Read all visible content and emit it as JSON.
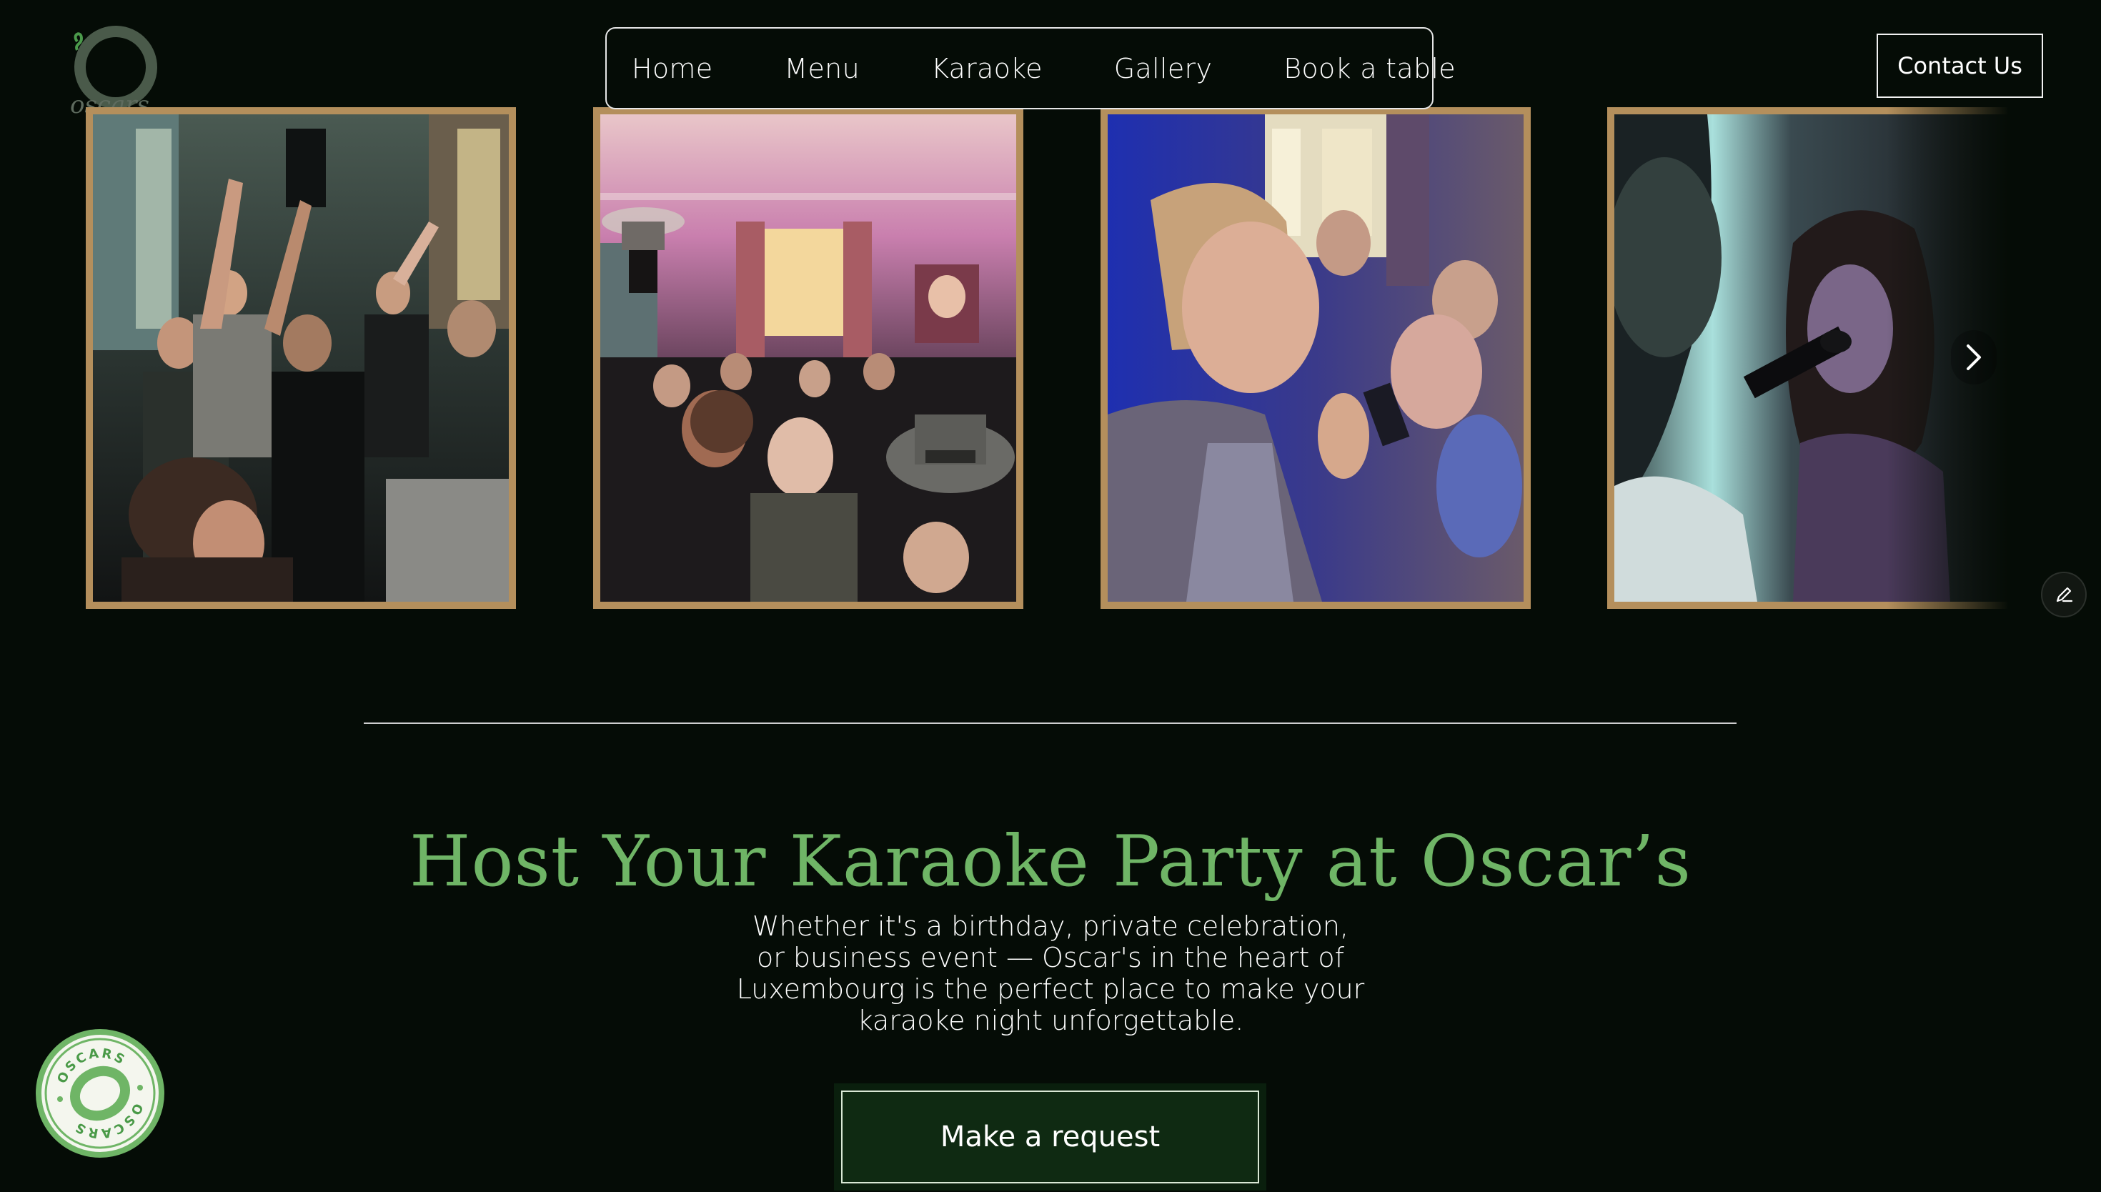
{
  "brand": {
    "logo_text": "oscars",
    "logo_letter": "O"
  },
  "nav": {
    "items": [
      {
        "label": "Home"
      },
      {
        "label": "Menu"
      },
      {
        "label": "Karaoke"
      },
      {
        "label": "Gallery"
      },
      {
        "label": "Book a table"
      }
    ]
  },
  "header": {
    "contact_label": "Contact Us"
  },
  "gallery": {
    "photos": [
      {
        "name": "crowd-cheering-photo"
      },
      {
        "name": "crowded-room-photo"
      },
      {
        "name": "woman-singing-photo"
      },
      {
        "name": "singer-microphone-photo"
      }
    ],
    "frame_color": "#b48f5c"
  },
  "main": {
    "heading": "Host Your Karaoke Party at Oscar’s",
    "body": "Whether it's a birthday, private celebration, or business event — Oscar's in the heart of Luxembourg is the perfect place to make your karaoke night unforgettable.",
    "cta_label": "Make a request"
  },
  "badge": {
    "text": "OSCARS",
    "letter": "O"
  },
  "colors": {
    "background": "#050c06",
    "accent_green": "#6fb566",
    "gold_frame": "#b48f5c",
    "cta_bg": "#0f2a12"
  },
  "icons": {
    "next": "chevron-right-icon",
    "edit": "pencil-icon"
  }
}
